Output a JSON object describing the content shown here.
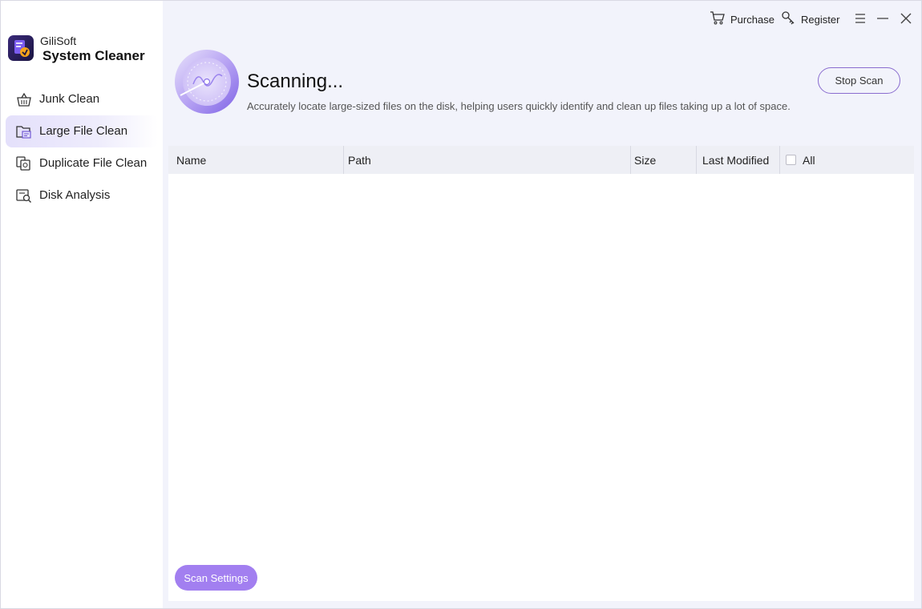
{
  "app": {
    "brand_small": "GiliSoft",
    "brand_big": "System Cleaner"
  },
  "sidebar": {
    "items": [
      {
        "label": "Junk Clean",
        "icon": "basket-icon",
        "active": false
      },
      {
        "label": "Large File Clean",
        "icon": "large-file-icon",
        "active": true
      },
      {
        "label": "Duplicate File Clean",
        "icon": "duplicate-file-icon",
        "active": false
      },
      {
        "label": "Disk Analysis",
        "icon": "disk-analysis-icon",
        "active": false
      }
    ]
  },
  "topbar": {
    "purchase_label": "Purchase",
    "register_label": "Register"
  },
  "scan": {
    "title": "Scanning...",
    "description": "Accurately locate large-sized files on the disk, helping users quickly identify and clean up files taking up a lot of space.",
    "stop_label": "Stop Scan"
  },
  "table": {
    "columns": [
      "Name",
      "Path",
      "Size",
      "Last Modified"
    ],
    "select_all_label": "All",
    "rows": []
  },
  "footer": {
    "scan_settings_label": "Scan Settings"
  },
  "colors": {
    "accent": "#a27ff0",
    "accent_border": "#8a6ccf",
    "main_bg": "#f2f3fb",
    "active_nav_bg": "#e4e0fb"
  }
}
